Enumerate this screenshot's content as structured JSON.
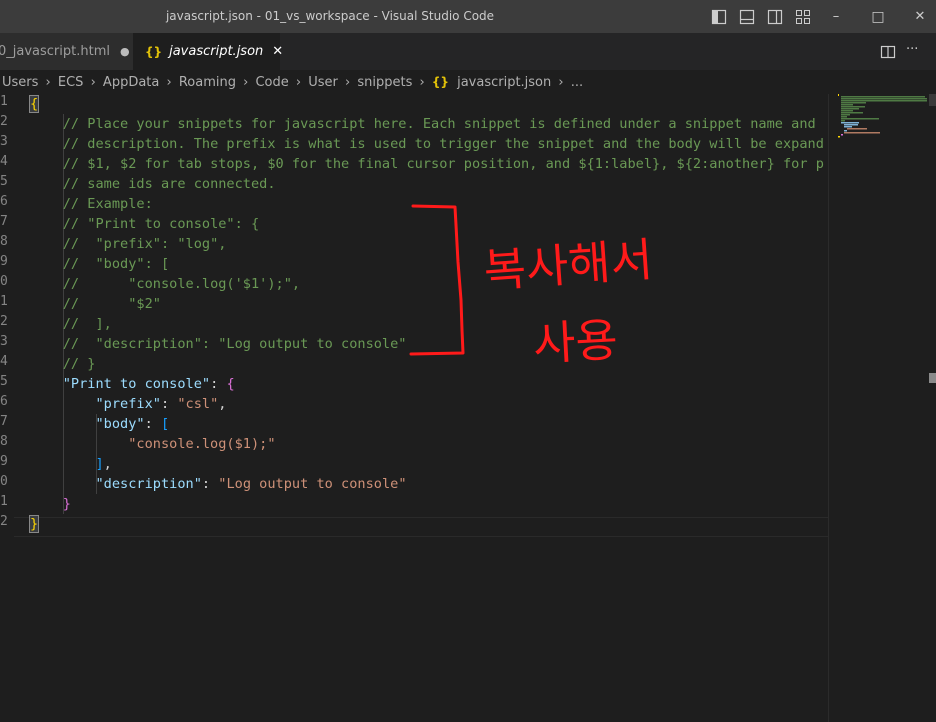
{
  "window": {
    "title": "javascript.json - 01_vs_workspace - Visual Studio Code",
    "controls": {
      "minimize": "–",
      "maximize": "□",
      "close": "✕"
    }
  },
  "tabs": [
    {
      "label": "0_javascript.html",
      "modified_dot": "●"
    },
    {
      "label": "javascript.json",
      "icon_text": "{}",
      "close": "✕"
    }
  ],
  "tab_actions": {
    "more": "···"
  },
  "breadcrumb": {
    "items": [
      "Users",
      "ECS",
      "AppData",
      "Roaming",
      "Code",
      "User",
      "snippets"
    ],
    "file_icon": "{}",
    "file": "javascript.json",
    "tail": "..."
  },
  "editor": {
    "line_numbers": [
      "1",
      "2",
      "3",
      "4",
      "5",
      "6",
      "7",
      "8",
      "9",
      "0",
      "1",
      "2",
      "3",
      "4",
      "5",
      "6",
      "7",
      "8",
      "9",
      "0",
      "1",
      "2"
    ],
    "code": {
      "open_brace": "{",
      "comments": [
        "// Place your snippets for javascript here. Each snippet is defined under a snippet name and",
        "// description. The prefix is what is used to trigger the snippet and the body will be expand",
        "// $1, $2 for tab stops, $0 for the final cursor position, and ${1:label}, ${2:another} for p",
        "// same ids are connected.",
        "// Example:",
        "// \"Print to console\": {",
        "//  \"prefix\": \"log\",",
        "//  \"body\": [",
        "//      \"console.log('$1');\",",
        "//      \"$2\"",
        "//  ],",
        "//  \"description\": \"Log output to console\"",
        "// }"
      ],
      "snippet_key": "\"Print to console\"",
      "prefix_key": "\"prefix\"",
      "prefix_value": "\"csl\"",
      "body_key": "\"body\"",
      "body_value": "\"console.log($1);\"",
      "description_key": "\"description\"",
      "description_value": "\"Log output to console\"",
      "close_brace": "}"
    }
  },
  "annotation": {
    "text_line1": "복사해서",
    "text_line2": "사용",
    "color": "#ff1a1a"
  },
  "colors": {
    "comment": "#6a9955",
    "key": "#9cdcfe",
    "string": "#ce9178",
    "bracket_gold": "#ffd700",
    "bracket_orchid": "#da70d6",
    "bracket_blue": "#179fff",
    "background": "#1e1e1e"
  }
}
